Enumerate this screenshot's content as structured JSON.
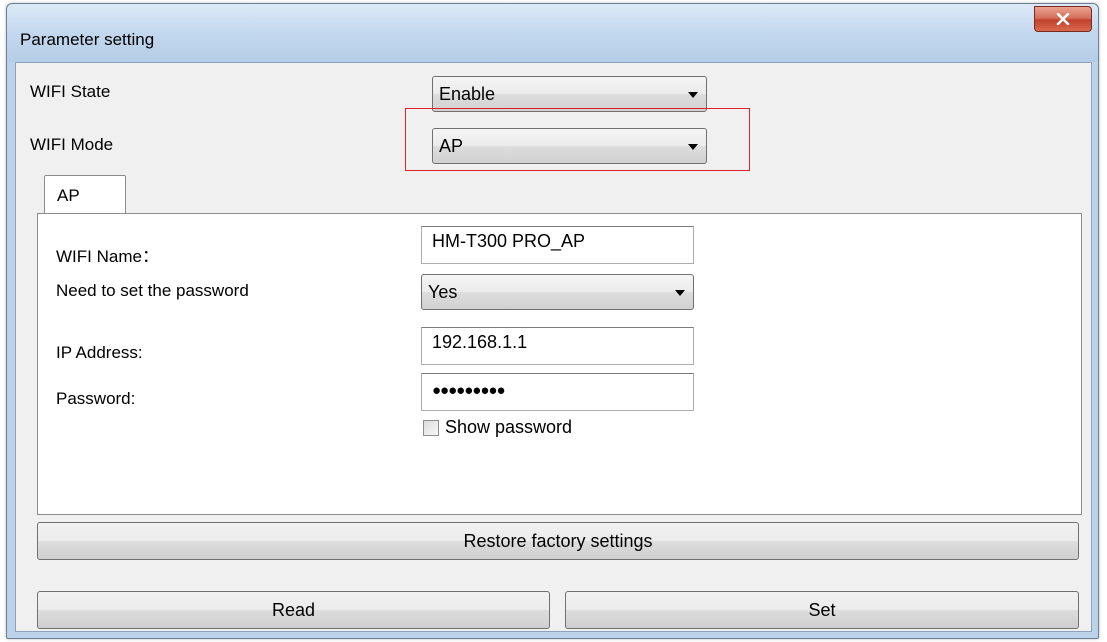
{
  "window": {
    "title": "Parameter setting",
    "close_icon": "close-icon"
  },
  "wifi_state": {
    "label": "WIFI State",
    "value": "Enable"
  },
  "wifi_mode": {
    "label": "WIFI Mode",
    "value": "AP"
  },
  "tabs": [
    {
      "label": "AP",
      "selected": true
    }
  ],
  "ap": {
    "wifi_name": {
      "label": "WIFI Name：",
      "value": "HM-T300 PRO_AP"
    },
    "need_password": {
      "label": "Need to set the password",
      "value": "Yes"
    },
    "ip_address": {
      "label": "IP Address:",
      "value": "192.168.1.1"
    },
    "password": {
      "label": "Password:",
      "value": "●●●●●●●●●"
    },
    "show_password": {
      "label": "Show password",
      "checked": false
    }
  },
  "buttons": {
    "restore": "Restore factory settings",
    "read": "Read",
    "set": "Set"
  },
  "colors": {
    "highlight": "#e0222a",
    "close_button": "#c2412b",
    "titlebar": "#c3d8ee"
  }
}
